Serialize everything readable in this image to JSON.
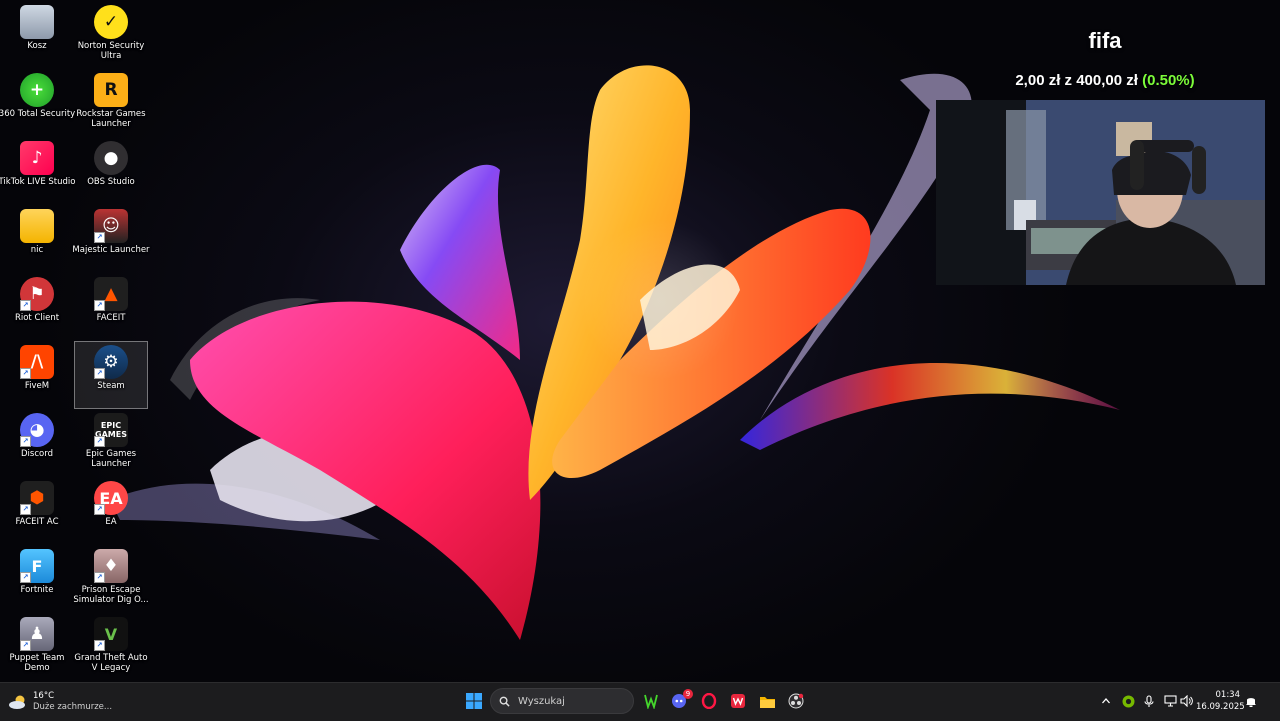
{
  "desktop_icons": [
    {
      "label": "Kosz",
      "icon": "recycle-bin-icon"
    },
    {
      "label": "Norton Security Ultra",
      "icon": "norton-icon"
    },
    {
      "label": "360 Total Security",
      "icon": "360-security-icon"
    },
    {
      "label": "Rockstar Games Launcher",
      "icon": "rockstar-icon"
    },
    {
      "label": "TikTok LIVE Studio",
      "icon": "tiktok-icon"
    },
    {
      "label": "OBS Studio",
      "icon": "obs-icon"
    },
    {
      "label": "nic",
      "icon": "folder-icon"
    },
    {
      "label": "Majestic Launcher",
      "icon": "majestic-icon"
    },
    {
      "label": "Riot Client",
      "icon": "riot-icon"
    },
    {
      "label": "FACEIT",
      "icon": "faceit-icon"
    },
    {
      "label": "FiveM",
      "icon": "fivem-icon"
    },
    {
      "label": "Steam",
      "icon": "steam-icon",
      "selected": true
    },
    {
      "label": "Discord",
      "icon": "discord-icon"
    },
    {
      "label": "Epic Games Launcher",
      "icon": "epic-games-icon",
      "glyph_text": "EPIC\nGAMES"
    },
    {
      "label": "FACEIT AC",
      "icon": "faceit-ac-icon"
    },
    {
      "label": "EA",
      "icon": "ea-icon",
      "glyph_text": "EA"
    },
    {
      "label": "Fortnite",
      "icon": "fortnite-icon",
      "glyph_text": "F"
    },
    {
      "label": "Prison Escape Simulator Dig O...",
      "icon": "prison-escape-icon"
    },
    {
      "label": "Puppet Team Demo",
      "icon": "puppet-team-icon"
    },
    {
      "label": "Grand Theft Auto V Legacy",
      "icon": "gta-v-icon",
      "glyph_text": "V"
    }
  ],
  "overlay": {
    "goal_title": "fifa",
    "goal_current": "2,00 zł",
    "goal_sep": "z",
    "goal_target": "400,00 zł",
    "goal_percent": "(0.50%)",
    "goal_percent_color": "#7CFC3A"
  },
  "taskbar": {
    "weather_temp": "16°C",
    "weather_desc": "Duże zachmurze...",
    "search_placeholder": "Wyszukaj",
    "pinned": [
      "start-icon",
      "search-icon",
      "razer-cortex-icon",
      "discord-icon",
      "opera-gx-icon",
      "wps-office-icon",
      "file-explorer-icon",
      "obs-icon"
    ],
    "discord_badge": "9",
    "tray": [
      "chevron-up-icon",
      "nvidia-icon",
      "microphone-icon",
      "network-icon",
      "volume-icon",
      "notification-icon"
    ],
    "time": "01:34",
    "date": "16.09.2025"
  },
  "colors": {
    "taskbar_bg": "#1c1c1e",
    "accent_green": "#7CFC3A"
  }
}
